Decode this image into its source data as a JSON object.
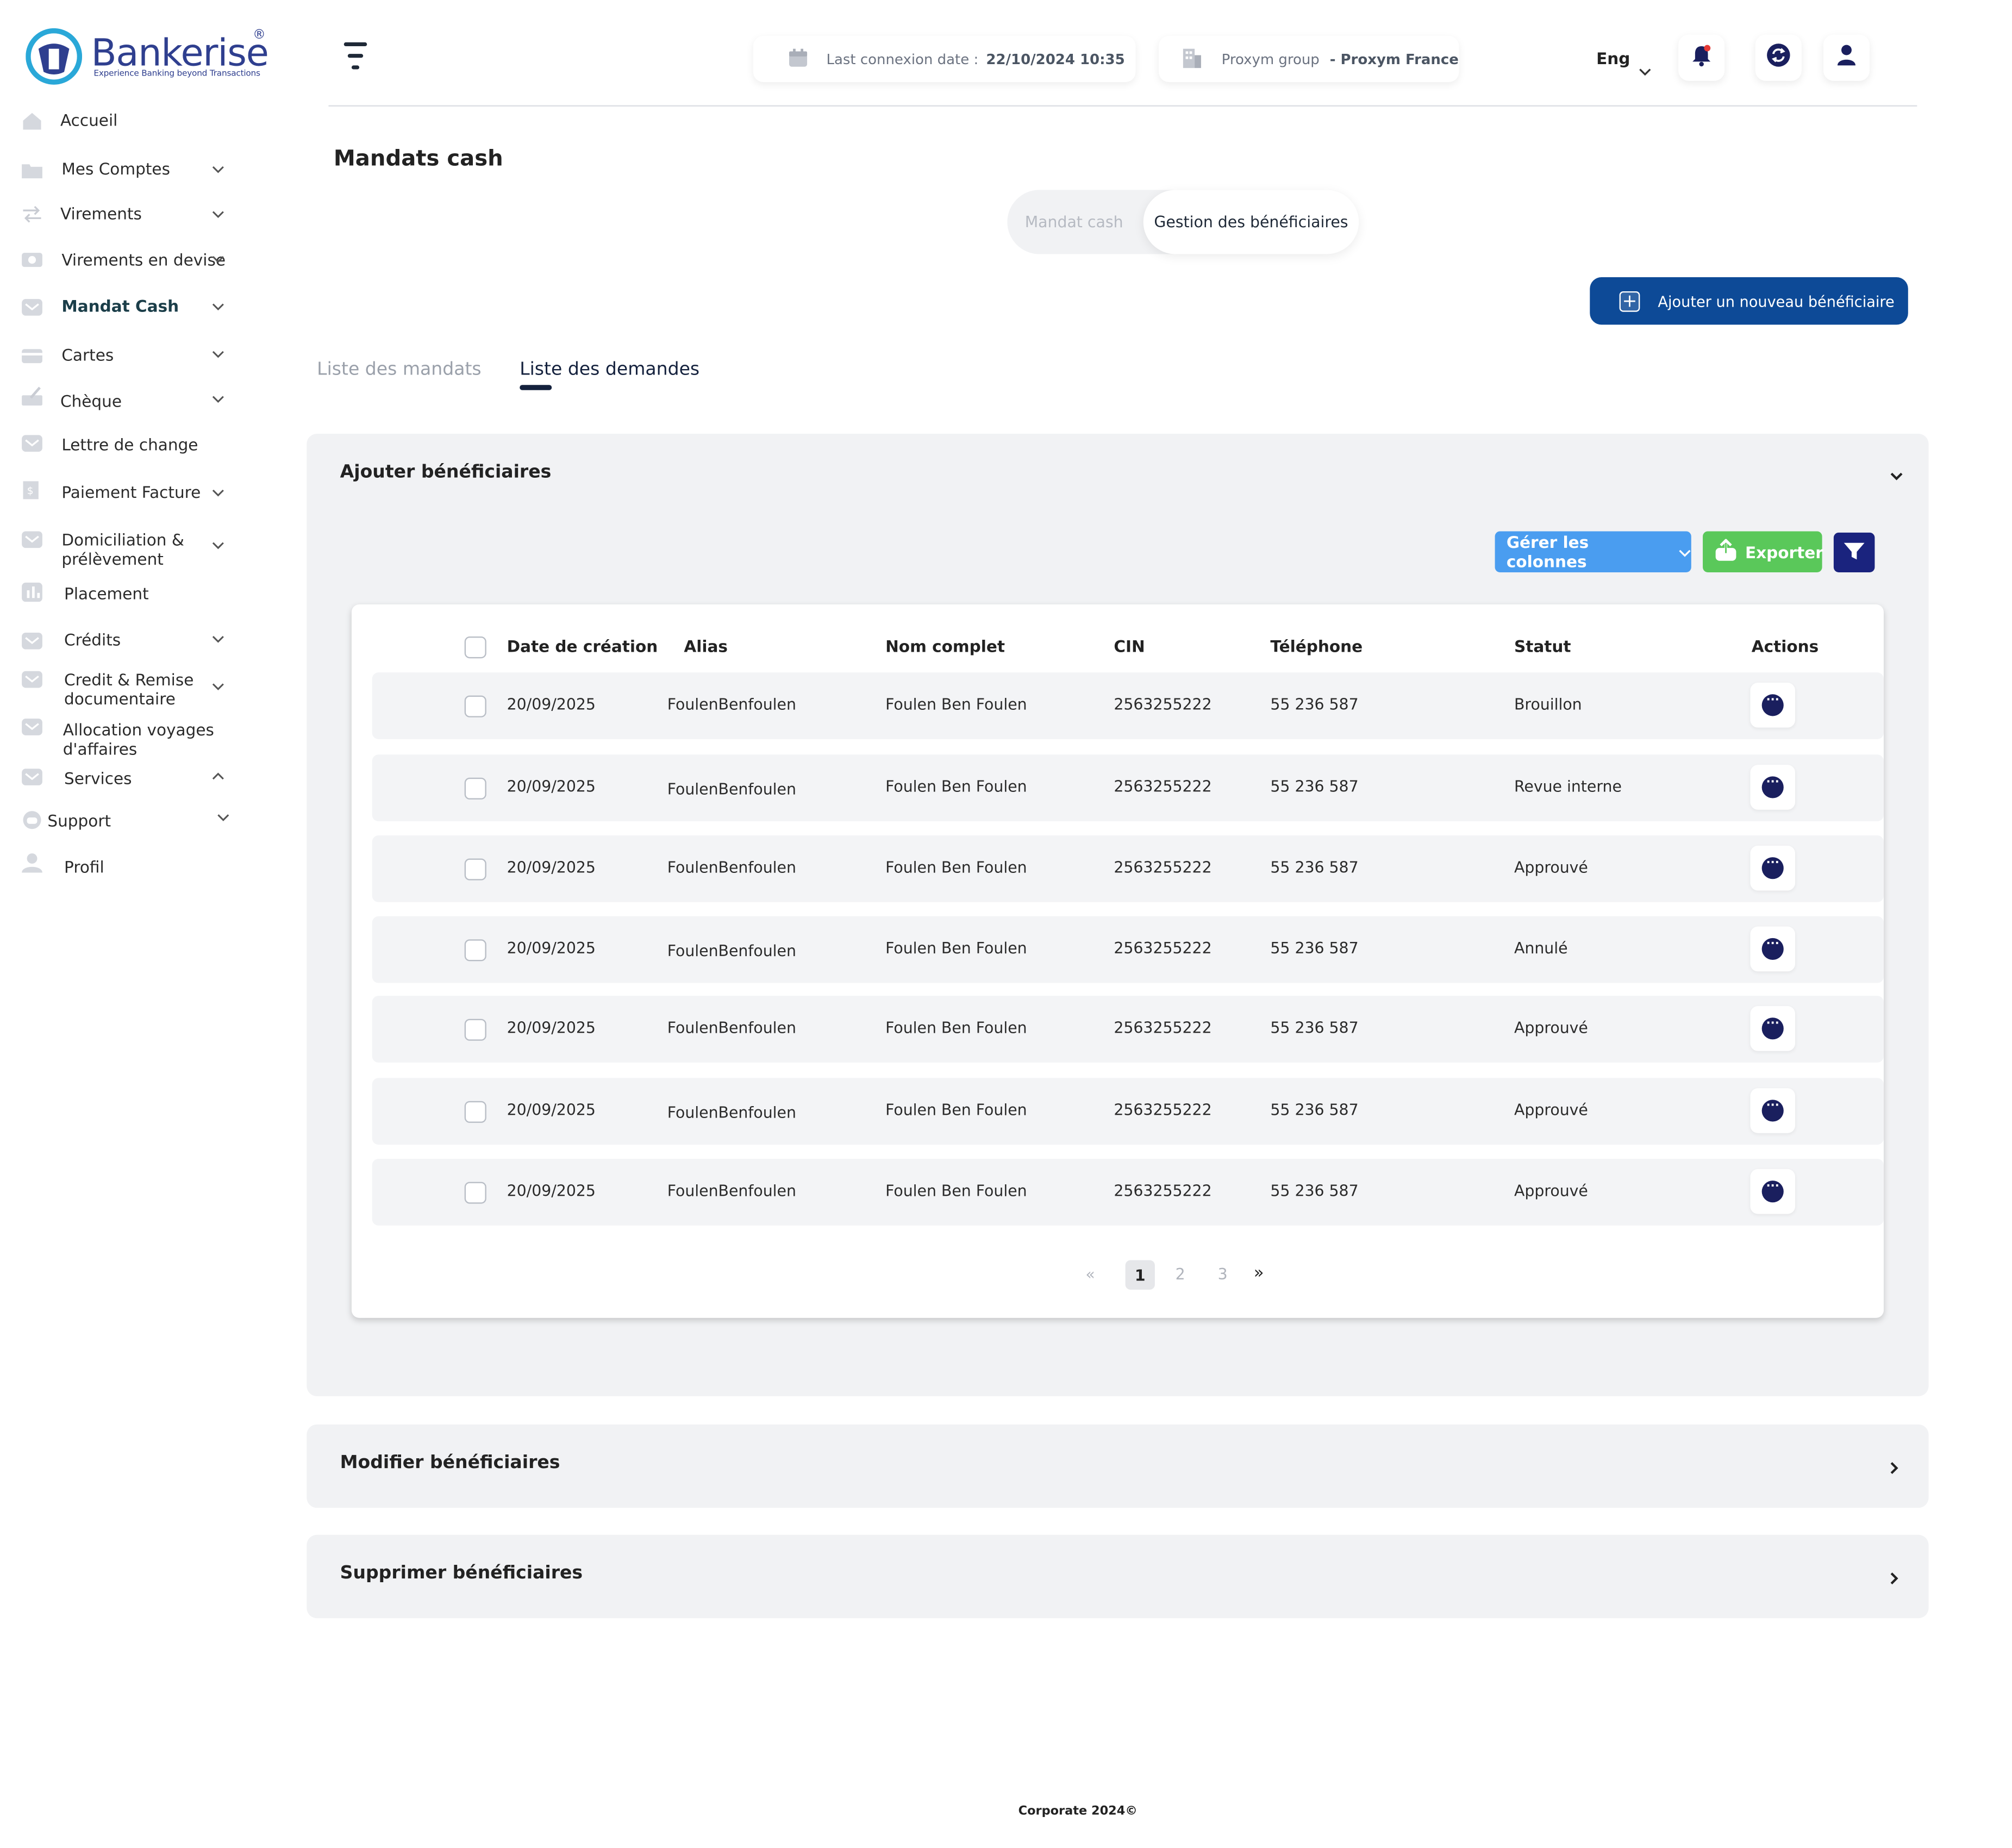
{
  "brand": {
    "name": "Bankerise",
    "registered": "®",
    "tagline": "Experience Banking beyond Transactions"
  },
  "sidebar": {
    "items": [
      {
        "label": "Accueil",
        "icon": "home-icon",
        "chevron": false
      },
      {
        "label": "Mes Comptes",
        "icon": "folder-icon",
        "chevron": "down"
      },
      {
        "label": "Virements",
        "icon": "transfer-icon",
        "chevron": "down"
      },
      {
        "label": "Virements en devise",
        "icon": "currency-icon",
        "chevron": "down"
      },
      {
        "label": "Mandat Cash",
        "icon": "mail-icon",
        "chevron": "down",
        "active": true
      },
      {
        "label": "Cartes",
        "icon": "card-icon",
        "chevron": "down"
      },
      {
        "label": "Chèque",
        "icon": "cheque-icon",
        "chevron": "down"
      },
      {
        "label": "Lettre de change",
        "icon": "mail-icon",
        "chevron": false
      },
      {
        "label": "Paiement Facture",
        "icon": "invoice-icon",
        "chevron": "down"
      },
      {
        "label": "Domiciliation &\nprélèvement",
        "icon": "mail-icon",
        "chevron": "down"
      },
      {
        "label": "Placement",
        "icon": "chart-icon",
        "chevron": false
      },
      {
        "label": "Crédits",
        "icon": "mail-icon",
        "chevron": "down"
      },
      {
        "label": "Credit & Remise\ndocumentaire",
        "icon": "mail-icon",
        "chevron": "down"
      },
      {
        "label": "Allocation  voyages\nd'affaires",
        "icon": "mail-icon",
        "chevron": false
      },
      {
        "label": "Services",
        "icon": "mail-icon",
        "chevron": "up"
      },
      {
        "label": "Support",
        "icon": "support-icon",
        "chevron": "down"
      },
      {
        "label": "Profil",
        "icon": "user-icon",
        "chevron": false
      }
    ]
  },
  "header": {
    "last_connexion_label": "Last connexion date :",
    "last_connexion_value": "22/10/2024 10:35",
    "group_label": "Proxym group",
    "group_value": "- Proxym France",
    "language": "Eng"
  },
  "main": {
    "title": "Mandats cash",
    "segments": [
      "Mandat cash",
      "Gestion des bénéficiaires"
    ],
    "add_button": "Ajouter un nouveau bénéficiaire",
    "tabs": [
      "Liste des mandats",
      "Liste des demandes"
    ],
    "panels": {
      "add": "Ajouter  bénéficiaires",
      "modify": "Modifier bénéficiaires",
      "delete": "Supprimer bénéficiaires"
    },
    "toolbar": {
      "columns": "Gérer les colonnes",
      "export": "Exporter"
    },
    "table": {
      "headers": [
        "Date de création",
        "Alias",
        "Nom complet",
        "CIN",
        "Téléphone",
        "Statut",
        "Actions"
      ],
      "rows": [
        [
          "20/09/2025",
          "FoulenBenfoulen",
          "Foulen Ben Foulen",
          "2563255222",
          "55 236 587",
          "Brouillon"
        ],
        [
          "20/09/2025",
          "FoulenBenfoulen",
          "Foulen Ben Foulen",
          "2563255222",
          "55 236 587",
          "Revue interne"
        ],
        [
          "20/09/2025",
          "FoulenBenfoulen",
          "Foulen Ben Foulen",
          "2563255222",
          "55 236 587",
          "Approuvé"
        ],
        [
          "20/09/2025",
          "FoulenBenfoulen",
          "Foulen Ben Foulen",
          "2563255222",
          "55 236 587",
          "Annulé"
        ],
        [
          "20/09/2025",
          "FoulenBenfoulen",
          "Foulen Ben Foulen",
          "2563255222",
          "55 236 587",
          "Approuvé"
        ],
        [
          "20/09/2025",
          "FoulenBenfoulen",
          "Foulen Ben Foulen",
          "2563255222",
          "55 236 587",
          "Approuvé"
        ],
        [
          "20/09/2025",
          "FoulenBenfoulen",
          "Foulen Ben Foulen",
          "2563255222",
          "55 236 587",
          "Approuvé"
        ]
      ]
    },
    "pagination": {
      "first": "«",
      "pages": [
        "1",
        "2",
        "3"
      ],
      "last": "»",
      "current": "1"
    }
  },
  "footer": "Corporate 2024©",
  "colors": {
    "primary": "#0d4a97",
    "navy": "#1a237e",
    "export": "#5ac85a",
    "columns": "#4a9df0",
    "panel": "#f1f2f4"
  }
}
